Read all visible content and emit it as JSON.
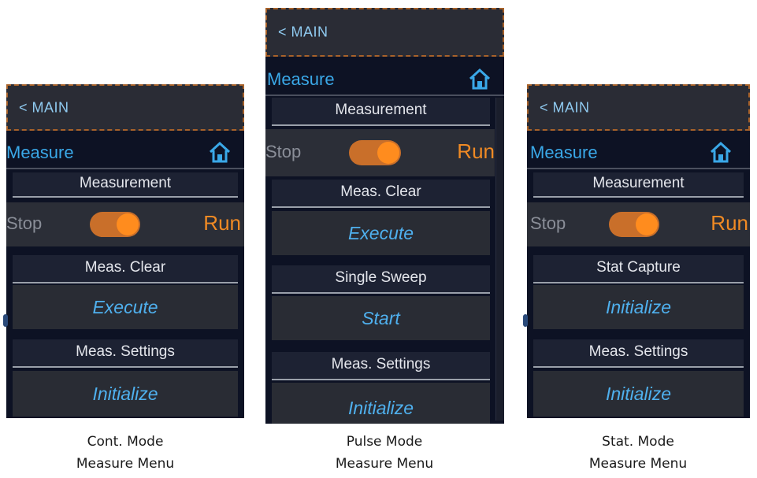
{
  "colors": {
    "accent": "#3aa8e8",
    "run": "#f08a24",
    "toggle": "#ff8c1e",
    "panel_bg": "#0d1224",
    "topbar_border": "#a8622a"
  },
  "panels": [
    {
      "back_label": "< MAIN",
      "title": "Measure",
      "home_icon": "home-icon",
      "measurement_header": "Measurement",
      "stop_label": "Stop",
      "run_label": "Run",
      "section1_header": "Meas. Clear",
      "section1_button": "Execute",
      "section2_header": "Meas. Settings",
      "section2_button": "Initialize",
      "caption_line1": "Cont. Mode",
      "caption_line2": "Measure Menu"
    },
    {
      "back_label": "< MAIN",
      "title": "Measure",
      "home_icon": "home-icon",
      "measurement_header": "Measurement",
      "stop_label": "Stop",
      "run_label": "Run",
      "section1_header": "Meas. Clear",
      "section1_button": "Execute",
      "section2_header": "Single Sweep",
      "section2_button": "Start",
      "section3_header": "Meas. Settings",
      "section3_button": "Initialize",
      "caption_line1": "Pulse Mode",
      "caption_line2": "Measure Menu"
    },
    {
      "back_label": "< MAIN",
      "title": "Measure",
      "home_icon": "home-icon",
      "measurement_header": "Measurement",
      "stop_label": "Stop",
      "run_label": "Run",
      "section1_header": "Stat Capture",
      "section1_button": "Initialize",
      "section2_header": "Meas. Settings",
      "section2_button": "Initialize",
      "caption_line1": "Stat. Mode",
      "caption_line2": "Measure Menu"
    }
  ]
}
